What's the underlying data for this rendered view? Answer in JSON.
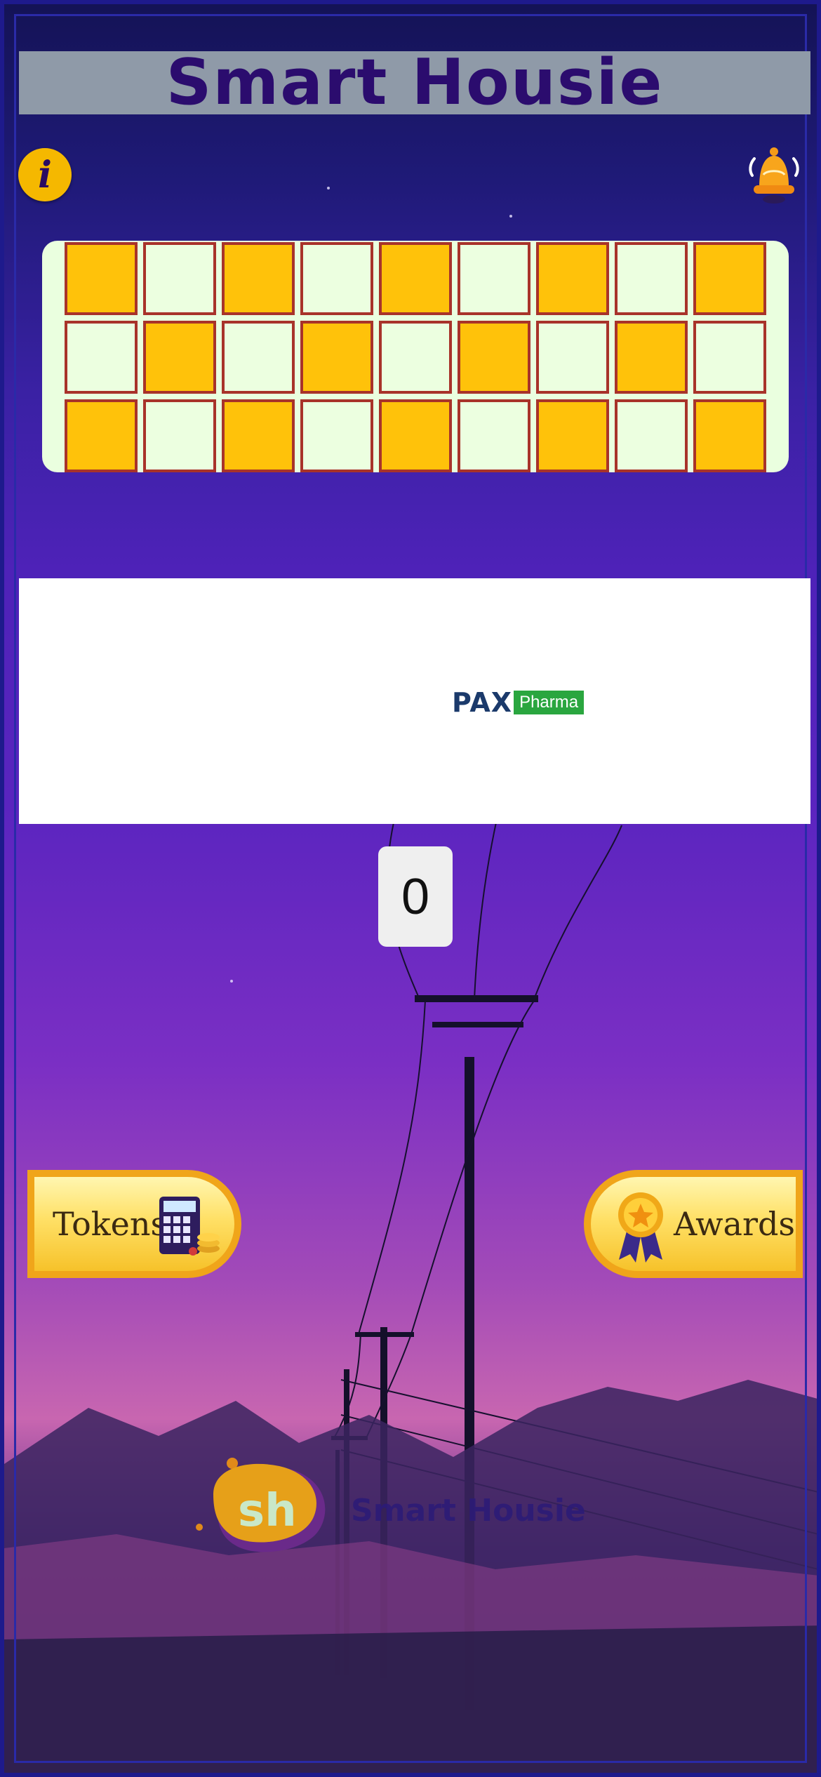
{
  "app": {
    "title": "Smart Housie"
  },
  "toolbar": {
    "info_icon": "info-icon",
    "bell_icon": "bell-icon"
  },
  "ticket": {
    "rows": [
      [
        "on",
        "off",
        "on",
        "off",
        "on",
        "off",
        "on",
        "off",
        "on"
      ],
      [
        "off",
        "on",
        "off",
        "on",
        "off",
        "on",
        "off",
        "on",
        "off"
      ],
      [
        "on",
        "off",
        "on",
        "off",
        "on",
        "off",
        "on",
        "off",
        "on"
      ]
    ],
    "colors": {
      "filled": "#ffc20a",
      "empty": "#ecffe0",
      "border": "#a8332a"
    }
  },
  "ad": {
    "brand": "PAX",
    "tag": "Pharma"
  },
  "counter": {
    "value": "0"
  },
  "buttons": {
    "tokens_label": "Tokens",
    "awards_label": "Awards"
  },
  "footer": {
    "logo_text": "sh",
    "brand_text": "Smart Housie"
  },
  "colors": {
    "accent": "#ffc20a",
    "title": "#2b0c6e",
    "header_bg": "#8f9aa8"
  }
}
